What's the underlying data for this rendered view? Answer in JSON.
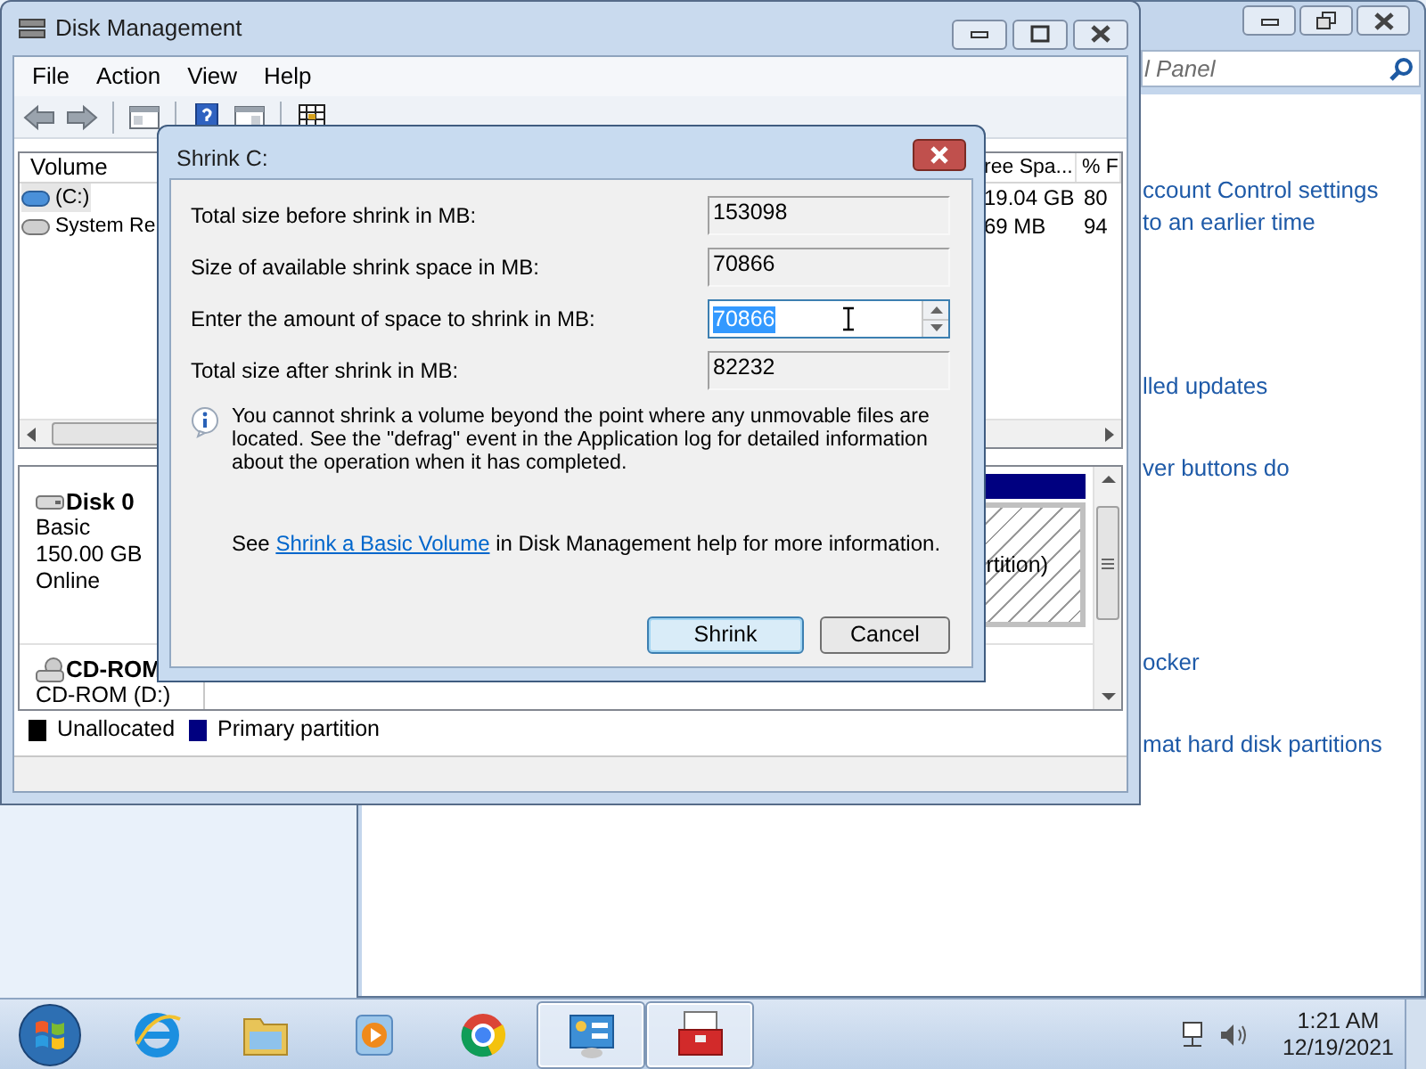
{
  "control_panel": {
    "search_placeholder": "l Panel",
    "links": [
      "ccount Control settings",
      "to an earlier time",
      "lled updates",
      "ver buttons do",
      "ocker",
      "mat hard disk partitions"
    ]
  },
  "disk_management": {
    "title": "Disk Management",
    "menu": [
      "File",
      "Action",
      "View",
      "Help"
    ],
    "columns": [
      "Volume",
      "ree Spa...",
      "% F"
    ],
    "volumes": [
      {
        "name": "(C:)",
        "free_space": "19.04 GB",
        "percent_free": "80",
        "selected": true
      },
      {
        "name": "System Re",
        "free_space": "69 MB",
        "percent_free": "94",
        "selected": false
      }
    ],
    "disks": [
      {
        "kind": "hard-disk",
        "name": "Disk 0",
        "details": [
          "Basic",
          "150.00 GB",
          "Online"
        ],
        "partition_text": "rtition)"
      },
      {
        "kind": "cd-rom",
        "name": "CD-ROM",
        "details": [
          "CD-ROM (D:)"
        ]
      }
    ],
    "legend": [
      {
        "label": "Unallocated",
        "color": "#000000"
      },
      {
        "label": "Primary partition",
        "color": "#000080"
      }
    ]
  },
  "dialog": {
    "title": "Shrink C:",
    "fields": [
      {
        "label": "Total size before shrink in MB:",
        "value": "153098",
        "kind": "readonly"
      },
      {
        "label": "Size of available shrink space in MB:",
        "value": "70866",
        "kind": "readonly"
      },
      {
        "label": "Enter the amount of space to shrink in MB:",
        "value": "70866",
        "kind": "spin",
        "text_selected": true
      },
      {
        "label": "Total size after shrink in MB:",
        "value": "82232",
        "kind": "readonly"
      }
    ],
    "info": "You cannot shrink a volume beyond the point where any unmovable files are located. See the \"defrag\" event in the Application log for detailed information about the operation when it has completed.",
    "help_before": "See ",
    "help_link": "Shrink a Basic Volume",
    "help_after": " in Disk Management help for more information.",
    "buttons": [
      {
        "label": "Shrink",
        "default": true
      },
      {
        "label": "Cancel",
        "default": false
      }
    ]
  },
  "taskbar": {
    "apps": [
      {
        "kind": "browser",
        "active": false
      },
      {
        "kind": "folder",
        "active": false
      },
      {
        "kind": "media",
        "active": false
      },
      {
        "kind": "globe",
        "active": false
      },
      {
        "kind": "control-panel",
        "active": true
      },
      {
        "kind": "toolbox",
        "active": true
      }
    ],
    "time": "1:21 AM",
    "date": "12/19/2021"
  }
}
